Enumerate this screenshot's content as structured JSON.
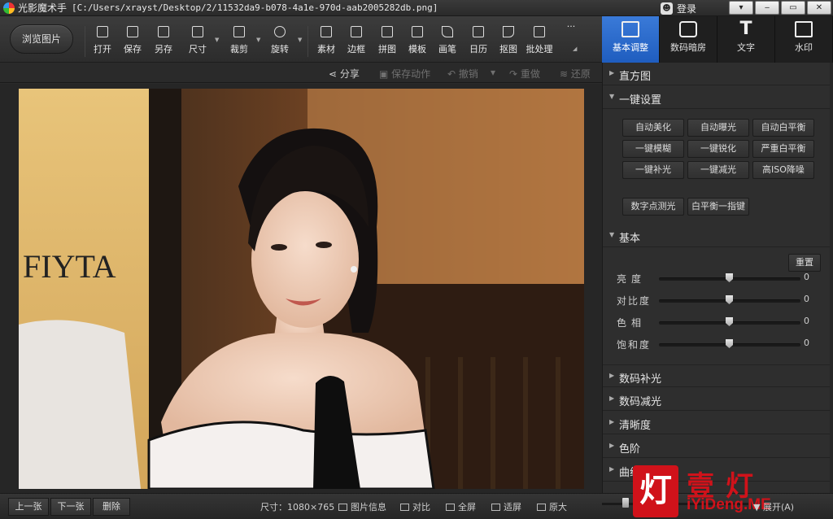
{
  "app": {
    "name": "光影魔术手",
    "file_path": "[C:/Users/xrayst/Desktop/2/11532da9-b078-4a1e-970d-aab2005282db.png]",
    "login_label": "登录"
  },
  "window_controls": [
    "▾",
    "‒",
    "▭",
    "✕"
  ],
  "toolbar": {
    "browse_label": "浏览图片",
    "tools": [
      {
        "label": "打开",
        "icon": "open-icon"
      },
      {
        "label": "保存",
        "icon": "save-icon"
      },
      {
        "label": "另存",
        "icon": "save-as-icon"
      },
      {
        "label": "尺寸",
        "icon": "resize-icon"
      },
      {
        "label": "裁剪",
        "icon": "crop-icon"
      },
      {
        "label": "旋转",
        "icon": "rotate-icon"
      },
      {
        "label": "素材",
        "icon": "material-icon"
      },
      {
        "label": "边框",
        "icon": "border-icon"
      },
      {
        "label": "拼图",
        "icon": "collage-icon"
      },
      {
        "label": "模板",
        "icon": "template-icon"
      },
      {
        "label": "画笔",
        "icon": "brush-icon"
      },
      {
        "label": "日历",
        "icon": "calendar-icon"
      },
      {
        "label": "抠图",
        "icon": "cutout-icon"
      },
      {
        "label": "批处理",
        "icon": "batch-icon"
      }
    ],
    "more_label": "···"
  },
  "right_tabs": [
    {
      "label": "基本调整",
      "icon": "edit-icon",
      "active": true
    },
    {
      "label": "数码暗房",
      "icon": "camera-icon",
      "active": false
    },
    {
      "label": "文字",
      "icon": "text-icon",
      "active": false
    },
    {
      "label": "水印",
      "icon": "watermark-icon",
      "active": false
    }
  ],
  "actionbar": {
    "share": "分享",
    "save_action": "保存动作",
    "undo": "撤销",
    "redo": "重做",
    "restore": "还原"
  },
  "photo": {
    "sign_text": "FIYTA"
  },
  "panel": {
    "histogram": "直方图",
    "one_click": "一键设置",
    "one_click_buttons": [
      "自动美化",
      "自动曝光",
      "自动白平衡",
      "一键模糊",
      "一键锐化",
      "严重白平衡",
      "一键补光",
      "一键减光",
      "高ISO降噪"
    ],
    "extra_buttons": [
      "数字点测光",
      "白平衡一指键"
    ],
    "basic": "基本",
    "reset": "重置",
    "sliders": [
      {
        "label": "亮度",
        "value": 0
      },
      {
        "label": "对比度",
        "value": 0
      },
      {
        "label": "色相",
        "value": 0
      },
      {
        "label": "饱和度",
        "value": 0
      }
    ],
    "sections": [
      "数码补光",
      "数码减光",
      "清晰度",
      "色阶",
      "曲线"
    ]
  },
  "statusbar": {
    "prev": "上一张",
    "next": "下一张",
    "delete": "删除",
    "size": "尺寸：1080×765",
    "info": "图片信息",
    "compare": "对比",
    "fullscreen": "全屏",
    "fit": "适屏",
    "original": "原大",
    "expand": "展开(A)"
  },
  "watermark": {
    "char": "灯",
    "cn": "壹灯",
    "en": "iYiDeng.ME"
  }
}
